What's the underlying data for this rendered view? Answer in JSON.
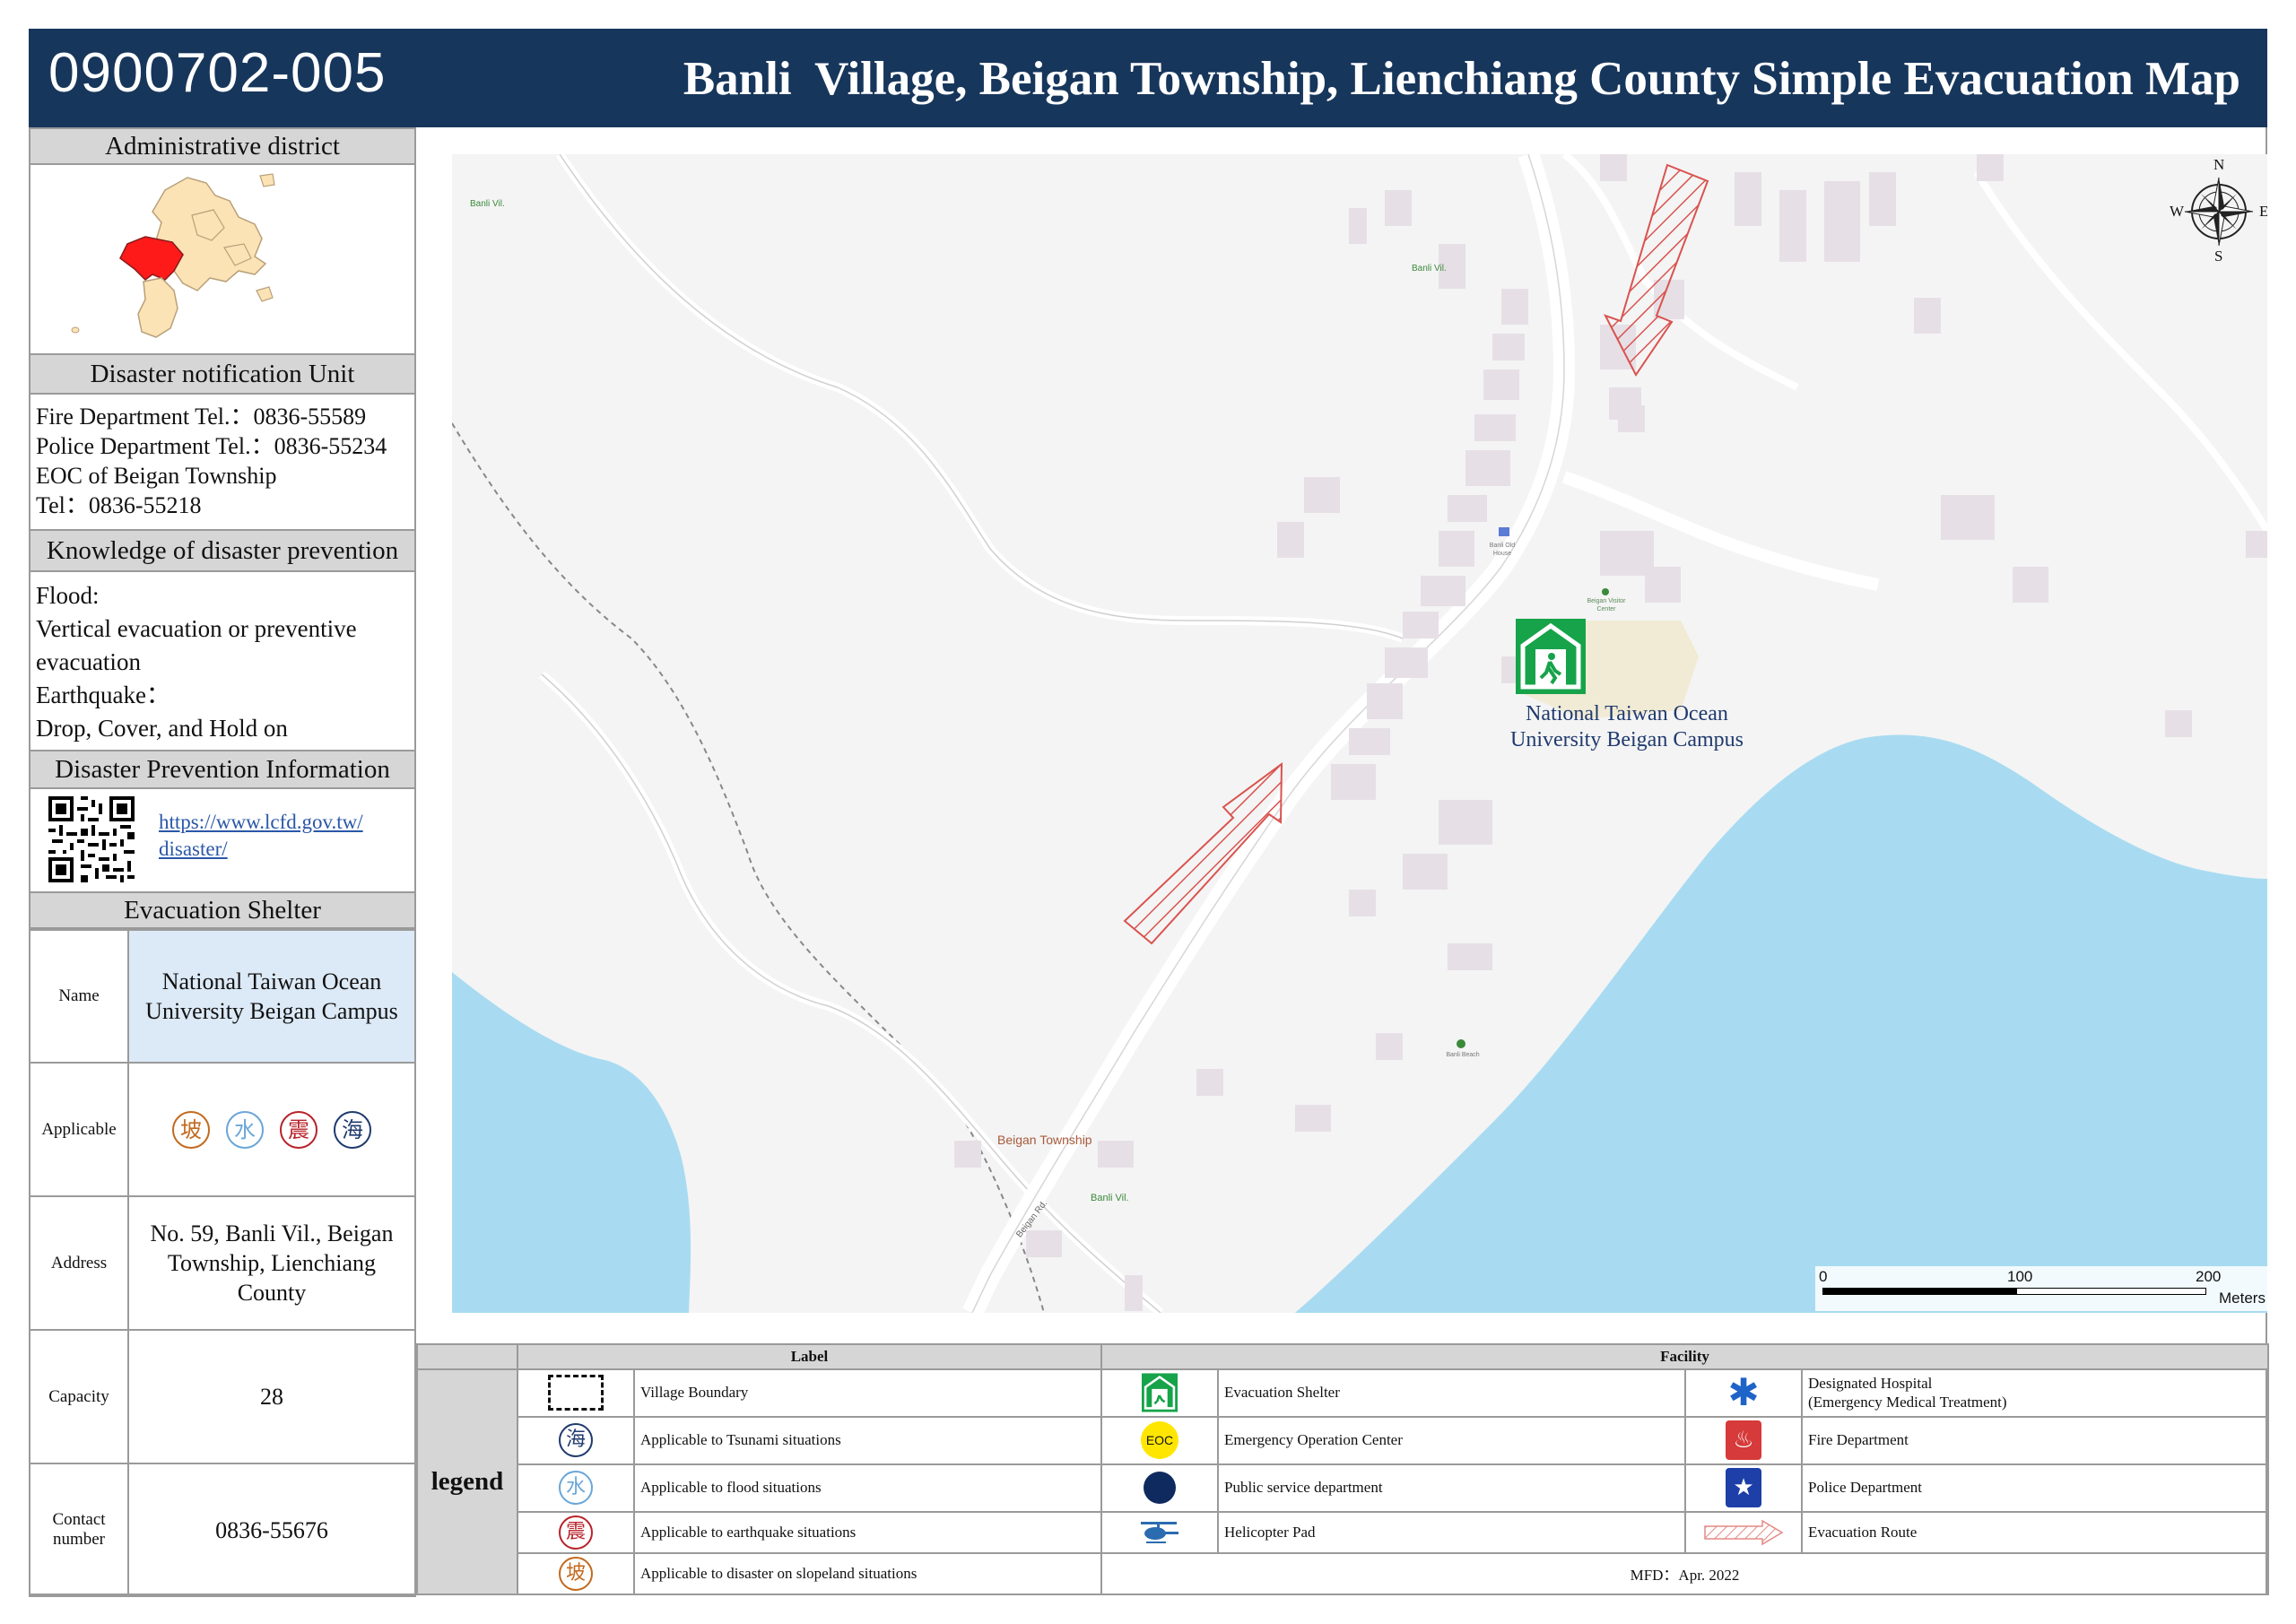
{
  "header": {
    "code": "0900702-005",
    "title": "Banli  Village, Beigan Township, Lienchiang County Simple Evacuation Map"
  },
  "sidebar": {
    "admin_district": {
      "title": "Administrative district"
    },
    "notification": {
      "title": "Disaster notification Unit",
      "lines": [
        "Fire Department Tel.：0836-55589",
        "Police Department Tel.：0836-55234",
        "EOC of Beigan Township",
        "Tel：0836-55218"
      ]
    },
    "knowledge": {
      "title": "Knowledge of disaster prevention",
      "lines": [
        "Flood:",
        "Vertical evacuation or preventive",
        "evacuation",
        "Earthquake：",
        "Drop, Cover, and Hold on"
      ]
    },
    "info": {
      "title": "Disaster Prevention Information",
      "link_line1": "https://www.lcfd.gov.tw/",
      "link_line2": "disaster/"
    },
    "shelter": {
      "title": "Evacuation Shelter",
      "name_label": "Name",
      "name_value": "National Taiwan Ocean University Beigan Campus",
      "applicable_label": "Applicable",
      "applicable_badges": [
        "坡",
        "水",
        "震",
        "海"
      ],
      "address_label": "Address",
      "address_value": "No. 59, Banli Vil., Beigan Township, Lienchiang County",
      "capacity_label": "Capacity",
      "capacity_value": "28",
      "contact_label": "Contact number",
      "contact_value": "0836-55676"
    }
  },
  "map": {
    "labels": {
      "banli_vil_1": "Banli Vil.",
      "banli_vil_2": "Banli Vil.",
      "banli_vil_3": "Banli Vil.",
      "beigan_township": "Beigan Township",
      "beigan_rd": "Beigan Rd.",
      "banli_old_house": "Banli Old House",
      "beigan_center": "Beigan Visitor Center",
      "banli_beach": "Banli Beach"
    },
    "shelter_label_line1": "National Taiwan Ocean",
    "shelter_label_line2": "University Beigan Campus",
    "compass": {
      "n": "N",
      "s": "S",
      "e": "E",
      "w": "W"
    },
    "scale": {
      "tick0": "0",
      "tick1": "100",
      "tick2": "200",
      "unit": "Meters"
    },
    "colors": {
      "land": "#f4f4f4",
      "water": "#a8dbf1",
      "road": "#ffffff",
      "building": "#e6e0e6",
      "route": "#d9534f",
      "shelter": "#16a34a"
    }
  },
  "legend": {
    "title": "legend",
    "label_header": "Label",
    "facility_header": "Facility",
    "labels": [
      {
        "icon": "village-boundary-icon",
        "text": "Village Boundary"
      },
      {
        "icon": "tsunami-icon",
        "glyph": "海",
        "text": "Applicable to Tsunami situations"
      },
      {
        "icon": "flood-icon",
        "glyph": "水",
        "text": "Applicable to flood situations"
      },
      {
        "icon": "earthquake-icon",
        "glyph": "震",
        "text": "Applicable to earthquake situations"
      },
      {
        "icon": "slope-icon",
        "glyph": "坡",
        "text": "Applicable to disaster on slopeland situations"
      }
    ],
    "facilities_left": [
      {
        "icon": "evacuation-shelter-icon",
        "text": "Evacuation Shelter"
      },
      {
        "icon": "eoc-icon",
        "glyph": "EOC",
        "text": "Emergency Operation Center"
      },
      {
        "icon": "public-service-icon",
        "text": "Public service department"
      },
      {
        "icon": "helicopter-icon",
        "text": "Helicopter Pad"
      }
    ],
    "facilities_right": [
      {
        "icon": "hospital-icon",
        "text": "Designated Hospital",
        "text2": "(Emergency Medical Treatment)"
      },
      {
        "icon": "fire-department-icon",
        "text": "Fire Department"
      },
      {
        "icon": "police-department-icon",
        "text": "Police Department"
      },
      {
        "icon": "evacuation-route-icon",
        "text": "Evacuation Route"
      }
    ],
    "footer": "MFD：Apr. 2022"
  }
}
